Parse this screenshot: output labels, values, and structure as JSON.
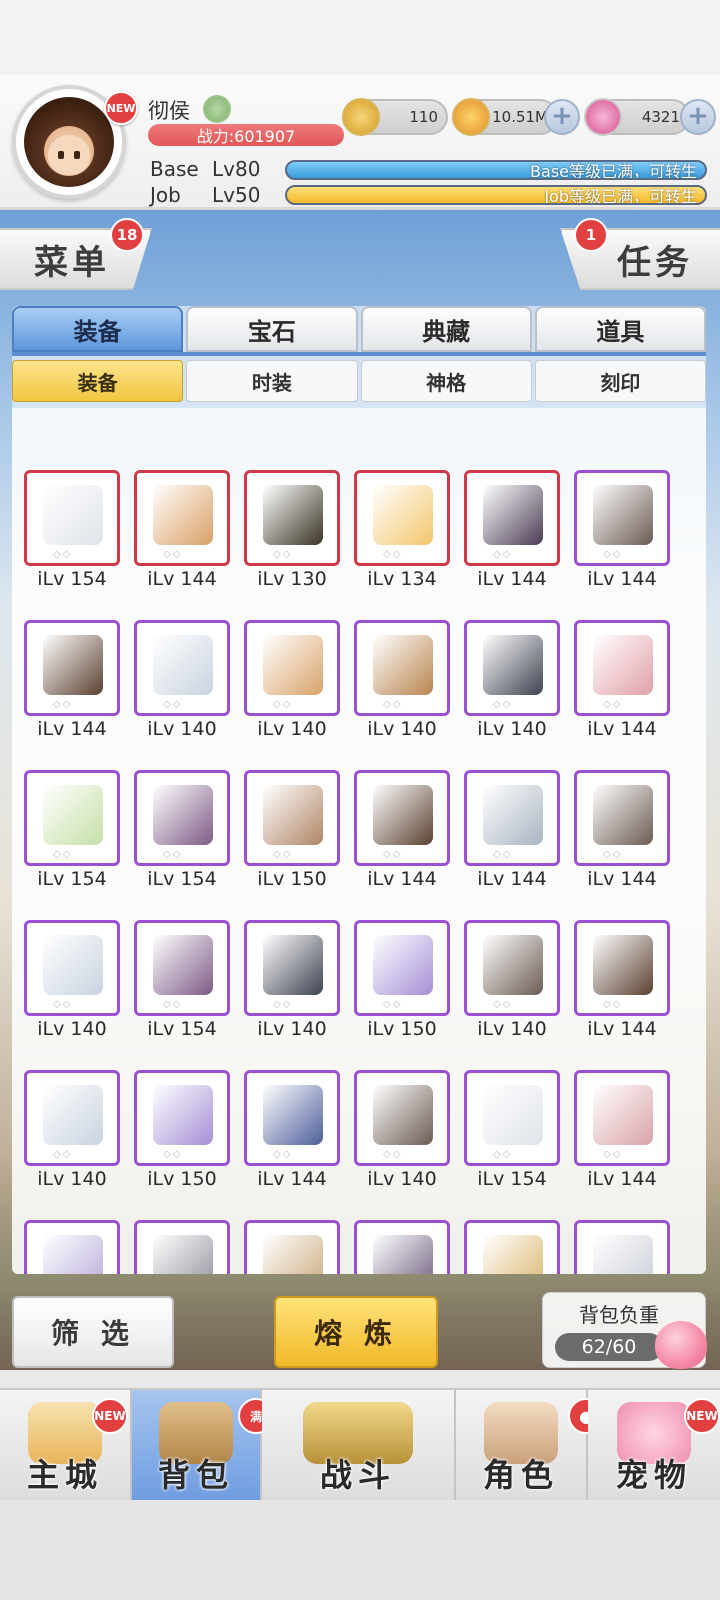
{
  "player": {
    "name": "彻侯",
    "power": "战力:601907",
    "new_badge": "NEW",
    "base_label": "Base",
    "base_level": "Lv80",
    "base_status": "Base等级已满，可转生",
    "job_label": "Job",
    "job_level": "Lv50",
    "job_status": "Job等级已满，可转生"
  },
  "currencies": [
    {
      "icon": "zeny-coin-icon",
      "value": "110",
      "color": "#e6b93a"
    },
    {
      "icon": "gold-coin-icon",
      "value": "10.51M",
      "color": "#f2a52a"
    },
    {
      "icon": "pink-gem-icon",
      "value": "4321",
      "color": "#e774b0"
    }
  ],
  "menu": {
    "label": "菜单",
    "count": "18"
  },
  "task": {
    "label": "任务",
    "count": "1"
  },
  "tabs": [
    "装备",
    "宝石",
    "典藏",
    "道具"
  ],
  "subtabs": [
    "装备",
    "时装",
    "神格",
    "刻印"
  ],
  "items": [
    {
      "ilv": "iLv 154",
      "rarity": "red",
      "icon": "white-boots-icon",
      "color": "#dfe3ea"
    },
    {
      "ilv": "iLv 144",
      "rarity": "red",
      "icon": "wooden-staff-icon",
      "color": "#d9a066"
    },
    {
      "ilv": "iLv 130",
      "rarity": "red",
      "icon": "dark-book-icon",
      "color": "#3a3424"
    },
    {
      "ilv": "iLv 134",
      "rarity": "red",
      "icon": "tiara-icon",
      "color": "#f2c66d"
    },
    {
      "ilv": "iLv 144",
      "rarity": "red",
      "icon": "dark-robe-icon",
      "color": "#4a3b54"
    },
    {
      "ilv": "iLv 144",
      "rarity": "purple",
      "icon": "katar-icon",
      "color": "#6b5a52"
    },
    {
      "ilv": "iLv 144",
      "rarity": "purple",
      "icon": "battle-axe-icon",
      "color": "#5a4030"
    },
    {
      "ilv": "iLv 140",
      "rarity": "purple",
      "icon": "sword-icon",
      "color": "#c9d3e0"
    },
    {
      "ilv": "iLv 140",
      "rarity": "purple",
      "icon": "bow-icon",
      "color": "#d8a36a"
    },
    {
      "ilv": "iLv 140",
      "rarity": "purple",
      "icon": "hammer-staff-icon",
      "color": "#b88450"
    },
    {
      "ilv": "iLv 140",
      "rarity": "purple",
      "icon": "dark-axe-icon",
      "color": "#3d4250"
    },
    {
      "ilv": "iLv 144",
      "rarity": "purple",
      "icon": "pink-bow-icon",
      "color": "#e0a0a8"
    },
    {
      "ilv": "iLv 154",
      "rarity": "purple",
      "icon": "leaf-cloak-icon",
      "color": "#c6dfa8"
    },
    {
      "ilv": "iLv 154",
      "rarity": "purple",
      "icon": "purple-ribbon-icon",
      "color": "#7d5a85"
    },
    {
      "ilv": "iLv 150",
      "rarity": "purple",
      "icon": "brown-cape-icon",
      "color": "#b08566"
    },
    {
      "ilv": "iLv 144",
      "rarity": "purple",
      "icon": "battle-axe-icon",
      "color": "#5a4030"
    },
    {
      "ilv": "iLv 144",
      "rarity": "purple",
      "icon": "dagger-icon",
      "color": "#a9b4c2"
    },
    {
      "ilv": "iLv 144",
      "rarity": "purple",
      "icon": "katar-icon",
      "color": "#6b5a52"
    },
    {
      "ilv": "iLv 140",
      "rarity": "purple",
      "icon": "sword-icon",
      "color": "#c9d3e0"
    },
    {
      "ilv": "iLv 154",
      "rarity": "purple",
      "icon": "purple-ribbon-icon",
      "color": "#7d5a85"
    },
    {
      "ilv": "iLv 140",
      "rarity": "purple",
      "icon": "dark-axe-icon",
      "color": "#3d4250"
    },
    {
      "ilv": "iLv 150",
      "rarity": "purple",
      "icon": "lavender-coat-icon",
      "color": "#a58fd6"
    },
    {
      "ilv": "iLv 140",
      "rarity": "purple",
      "icon": "katar-icon",
      "color": "#6b5a52"
    },
    {
      "ilv": "iLv 144",
      "rarity": "purple",
      "icon": "battle-axe-icon",
      "color": "#5a4030"
    },
    {
      "ilv": "iLv 140",
      "rarity": "purple",
      "icon": "sword-icon",
      "color": "#c9d3e0"
    },
    {
      "ilv": "iLv 150",
      "rarity": "purple",
      "icon": "lavender-coat-icon",
      "color": "#a58fd6"
    },
    {
      "ilv": "iLv 144",
      "rarity": "purple",
      "icon": "blue-book-icon",
      "color": "#4e5e9a"
    },
    {
      "ilv": "iLv 140",
      "rarity": "purple",
      "icon": "katar-icon",
      "color": "#6b5a52"
    },
    {
      "ilv": "iLv 154",
      "rarity": "purple",
      "icon": "white-boots-icon",
      "color": "#dfe3ea"
    },
    {
      "ilv": "iLv 144",
      "rarity": "purple",
      "icon": "goggles-icon",
      "color": "#d9a3a8"
    },
    {
      "ilv": "",
      "rarity": "purple",
      "icon": "partial-item-icon",
      "color": "#b6a9d8"
    },
    {
      "ilv": "",
      "rarity": "purple",
      "icon": "partial-item-icon",
      "color": "#8f8f9a"
    },
    {
      "ilv": "",
      "rarity": "purple",
      "icon": "partial-item-icon",
      "color": "#c9a77a"
    },
    {
      "ilv": "",
      "rarity": "purple",
      "icon": "partial-item-icon",
      "color": "#6a5a7a"
    },
    {
      "ilv": "",
      "rarity": "purple",
      "icon": "partial-item-icon",
      "color": "#d8b46a"
    },
    {
      "ilv": "",
      "rarity": "purple",
      "icon": "partial-item-icon",
      "color": "#c8ccd6"
    }
  ],
  "actions": {
    "filter": "筛 选",
    "smelt": "熔 炼"
  },
  "bag_weight": {
    "label": "背包负重",
    "value": "62/60"
  },
  "nav": [
    {
      "label": "主城",
      "badge": "NEW",
      "icon": "castle-icon",
      "color": "#e8b45a"
    },
    {
      "label": "背包",
      "badge": "满",
      "icon": "backpack-icon",
      "color": "#c69a5a"
    },
    {
      "label": "战斗",
      "badge": "",
      "icon": "battle-shield-icon",
      "color": "#c9a34a"
    },
    {
      "label": "角色",
      "badge": "",
      "icon": "character-icon",
      "color": "#e6c49a"
    },
    {
      "label": "宠物",
      "badge": "NEW",
      "icon": "pet-poring-icon",
      "color": "#f5a3bd"
    }
  ]
}
